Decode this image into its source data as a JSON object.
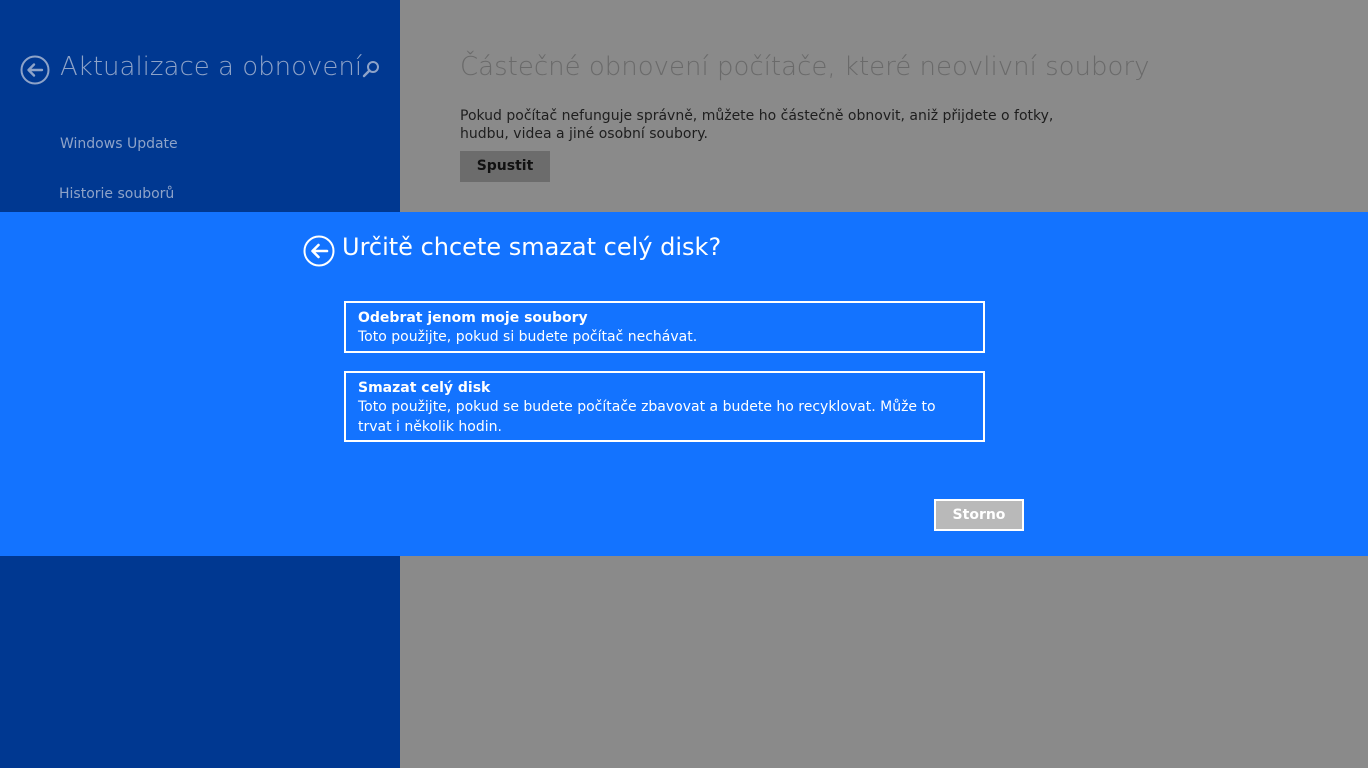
{
  "colors": {
    "sidebar_bg": "#003891",
    "main_bg": "#8a8a8a",
    "dialog_bg": "#1373ff",
    "cancel_bg": "#b9b9b9"
  },
  "sidebar": {
    "title": "Aktualizace a obnovení",
    "back_icon": "back-arrow-icon",
    "search_icon": "search-icon",
    "items": [
      {
        "label": "Windows Update"
      },
      {
        "label": "Historie souborů"
      }
    ]
  },
  "main": {
    "heading": "Částečné obnovení počítače, které neovlivní soubory",
    "description": "Pokud počítač nefunguje správně, můžete ho částečně obnovit, aniž přijdete o fotky, hudbu, videa a jiné osobní soubory.",
    "start_button": "Spustit"
  },
  "dialog": {
    "title": "Určitě chcete smazat celý disk?",
    "back_icon": "back-arrow-icon",
    "options": [
      {
        "title": "Odebrat jenom moje soubory",
        "description": "Toto použijte, pokud si budete počítač nechávat."
      },
      {
        "title": "Smazat celý disk",
        "description": "Toto použijte, pokud se budete počítače zbavovat a budete ho recyklovat. Může to trvat i několik hodin."
      }
    ],
    "cancel_button": "Storno"
  }
}
